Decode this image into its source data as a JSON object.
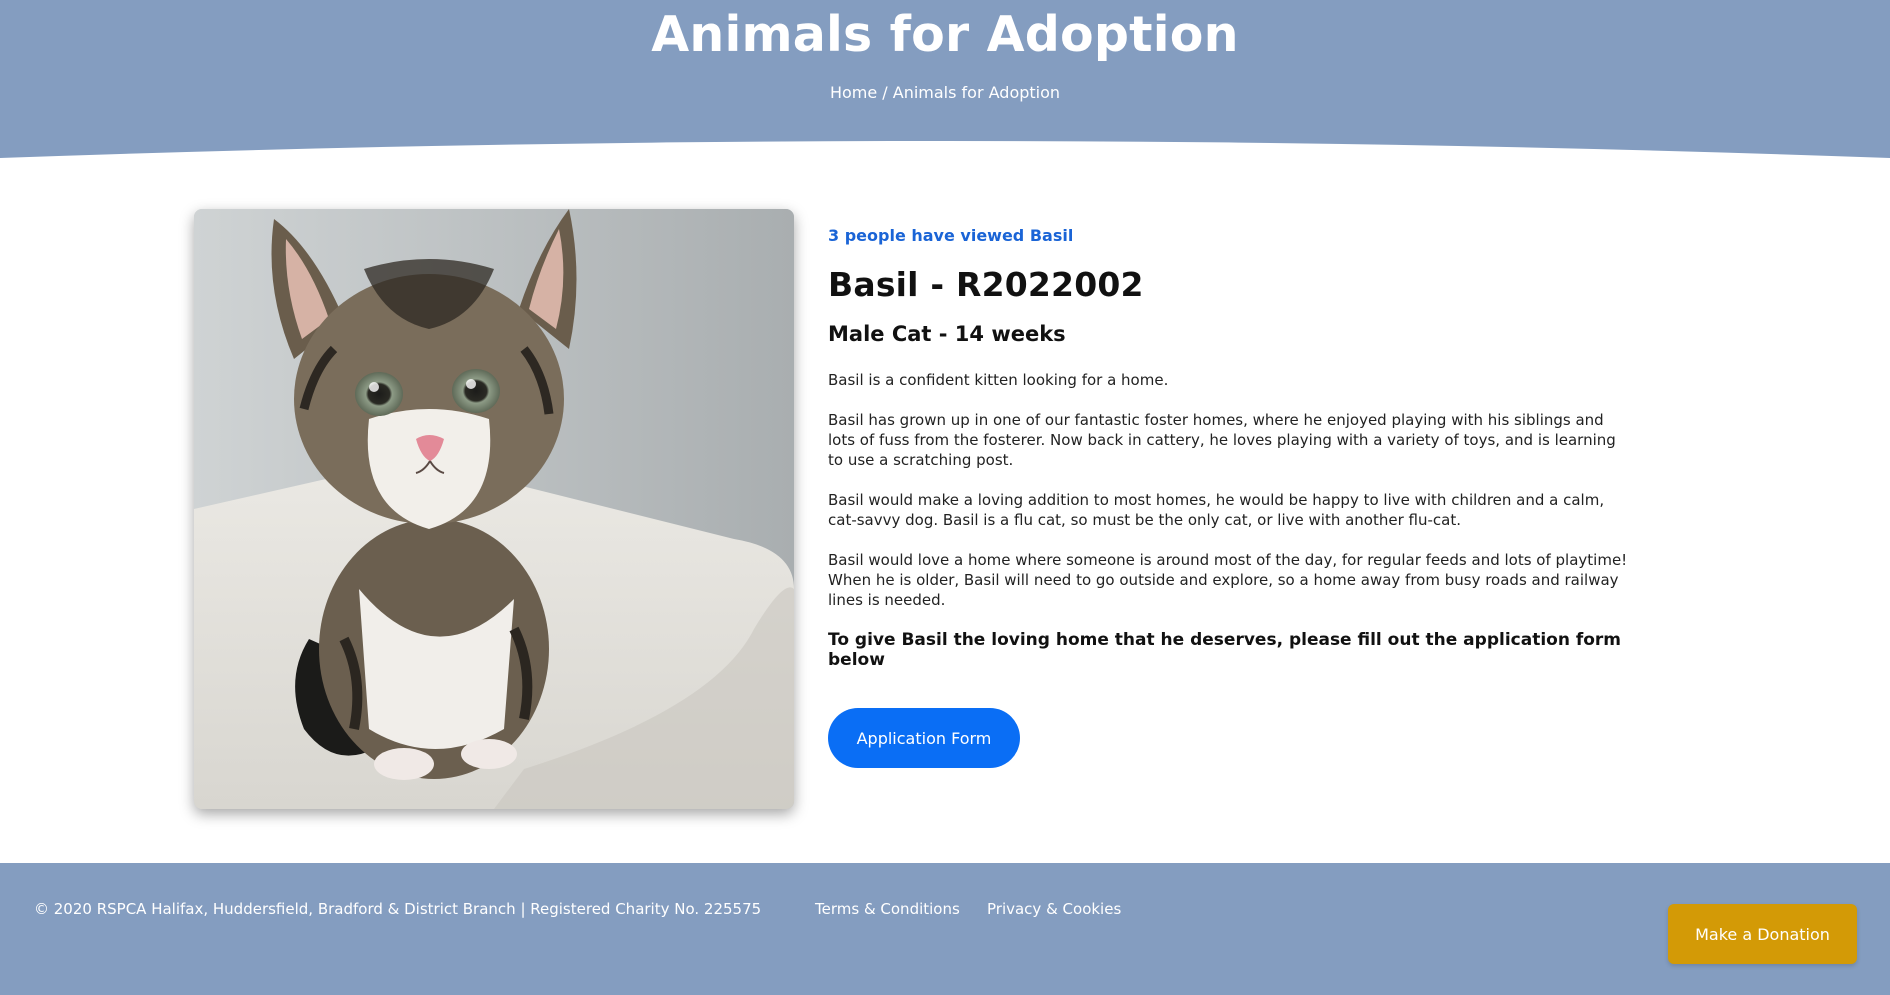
{
  "header": {
    "title": "Animals for Adoption",
    "breadcrumb": {
      "home": "Home",
      "separator": " / ",
      "current": "Animals for Adoption"
    }
  },
  "animal": {
    "views": "3 people have viewed Basil",
    "name": "Basil - R2022002",
    "subtitle": "Male Cat - 14 weeks",
    "paragraphs": [
      "Basil is a confident kitten looking for a home.",
      "Basil has grown up in one of our fantastic foster homes, where he enjoyed playing with his siblings and lots of fuss from the fosterer. Now back in cattery, he loves playing with a variety of toys, and is learning to use a scratching post.",
      "Basil would make a loving addition to most homes, he would be happy to live with children and a calm, cat-savvy dog. Basil is a flu cat, so must be the only cat, or live with another flu-cat.",
      "Basil would love a home where someone is around most of the day, for regular feeds and lots of playtime! When he is older, Basil will need to go outside and explore, so a home away from busy roads and railway lines is needed."
    ],
    "cta": "To give Basil the loving home that he deserves, please fill out the application form below",
    "button_label": "Application Form"
  },
  "footer": {
    "copyright": "© 2020 RSPCA Halifax, Huddersfield, Bradford & District Branch | Registered Charity No. 225575",
    "links": [
      "Terms & Conditions",
      "Privacy & Cookies"
    ],
    "donate_label": "Make a Donation"
  },
  "colors": {
    "header_bg": "#849dc0",
    "accent_blue": "#0a6ef5",
    "views_text": "#1a64d6",
    "donate_bg": "#d39a06"
  }
}
